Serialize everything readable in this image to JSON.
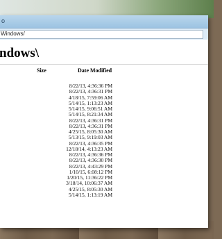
{
  "window": {
    "title": "o",
    "address": "Windows/"
  },
  "listing": {
    "heading": "ndows\\",
    "columns": {
      "size": "Size",
      "date_modified": "Date Modified"
    },
    "rows": [
      {
        "date": "8/22/13, 4:36:36 PM"
      },
      {
        "date": "8/22/13, 4:36:31 PM"
      },
      {
        "date": "4/18/15, 7:59:06 AM"
      },
      {
        "date": "5/14/15, 1:13:23 AM"
      },
      {
        "date": "5/14/15, 9:06:51 AM"
      },
      {
        "date": "5/14/15, 8:21:34 AM"
      },
      {
        "date": "8/22/13, 4:36:31 PM"
      },
      {
        "date": "8/22/13, 4:36:31 PM"
      },
      {
        "date": "4/25/15, 8:05:30 AM"
      },
      {
        "date": "5/13/15, 9:19:03 AM"
      },
      {
        "date": "8/22/13, 4:36:35 PM"
      },
      {
        "date": "12/18/14, 4:13:23 AM"
      },
      {
        "date": "8/22/13, 4:36:36 PM"
      },
      {
        "date": "8/22/13, 4:36:30 PM"
      },
      {
        "date": "8/22/13, 4:43:29 PM"
      },
      {
        "date": "1/10/15, 6:08:12 PM"
      },
      {
        "date": "1/20/15, 11:36:22 PM"
      },
      {
        "date": "3/18/14, 10:06:37 AM"
      },
      {
        "date": "4/25/15, 8:05:30 AM"
      },
      {
        "date": "5/14/15, 1:13:19 AM"
      }
    ]
  }
}
